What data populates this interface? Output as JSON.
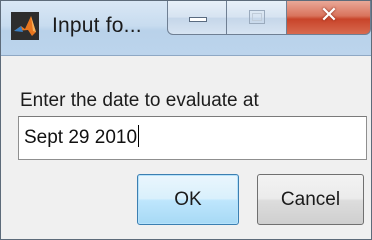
{
  "window": {
    "title": "Input fo...",
    "controls": {
      "minimize": "minimize-icon",
      "maximize": "maximize-icon",
      "close": "close-icon"
    }
  },
  "dialog": {
    "prompt": "Enter the date to evaluate at",
    "input_value": "Sept 29 2010",
    "ok_label": "OK",
    "cancel_label": "Cancel"
  },
  "colors": {
    "accent": "#3c7fb1",
    "close_button": "#c8442a"
  }
}
